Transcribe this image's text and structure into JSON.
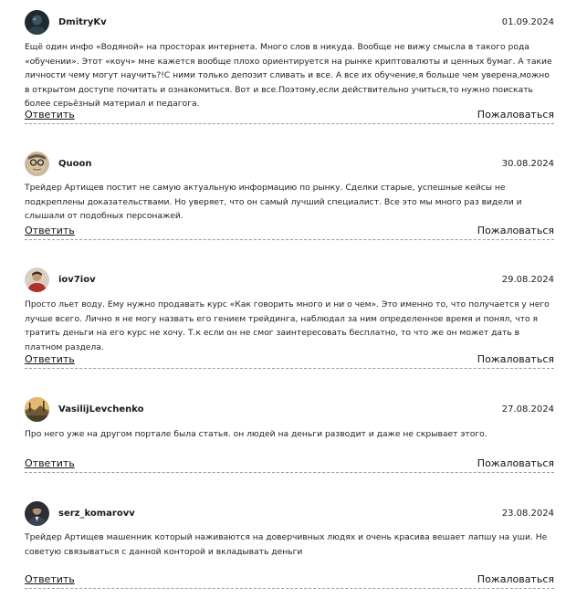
{
  "comments": [
    {
      "username": "DmitryKv",
      "date": "01.09.2024",
      "text": "Ещё один инфо «Водяной» на просторах интернета. Много слов в никуда. Вообще не вижу смысла в такого рода «обучении». Этот «коуч» мне кажется вообще плохо ориентируется на рынке криптовалюты и ценных бумаг. А такие личности чему могут научить?!С ними только депозит сливать и все. А все их обучение,я больше чем уверена,можно в открытом доступе почитать и ознакомиться. Вот и все.Поэтому,если действительно учиться,то нужно поискать более серьёзный материал и педагога.",
      "reply_label": "Ответить",
      "complain_label": "Пожаловаться",
      "avatar_icon": "avatar-dark-user"
    },
    {
      "username": "Quoon",
      "date": "30.08.2024",
      "text": "Трейдер Артищев постит не самую актуальную информацию по рынку. Сделки старые, успешные кейсы не подкреплены доказательствами. Но уверяет, что он самый лучший специалист. Все это мы много раз видели и слышали от подобных персонажей.",
      "reply_label": "Ответить",
      "complain_label": "Пожаловаться",
      "avatar_icon": "avatar-glasses-face"
    },
    {
      "username": "iov7iov",
      "date": "29.08.2024",
      "text": "Просто льет воду. Ему нужно продавать курс «Как говорить много и ни о чем». Это именно то, что получается у него лучше всего. Лично я не могу назвать его гением трейдинга, наблюдал за ним определенное время и понял, что я тратить деньги на его курс не хочу. Т.к если он не смог заинтересовать бесплатно, то что же он может дать в платном раздела.",
      "reply_label": "Ответить",
      "complain_label": "Пожаловаться",
      "avatar_icon": "avatar-red-shirt"
    },
    {
      "username": "VasilijLevchenko",
      "date": "27.08.2024",
      "text": "Про него уже на другом портале была статья. он людей на деньги разводит и даже не скрывает этого.",
      "reply_label": "Ответить",
      "complain_label": "Пожаловаться",
      "avatar_icon": "avatar-landscape"
    },
    {
      "username": "serz_komarovv",
      "date": "23.08.2024",
      "text": "Трейдер Артищев машенник который наживаются на доверчивных людях и очень красива вешает лапшу на уши. Не советую связываться с данной конторой и вкладывать деньги",
      "reply_label": "Ответить",
      "complain_label": "Пожаловаться",
      "avatar_icon": "avatar-suit-man"
    }
  ]
}
